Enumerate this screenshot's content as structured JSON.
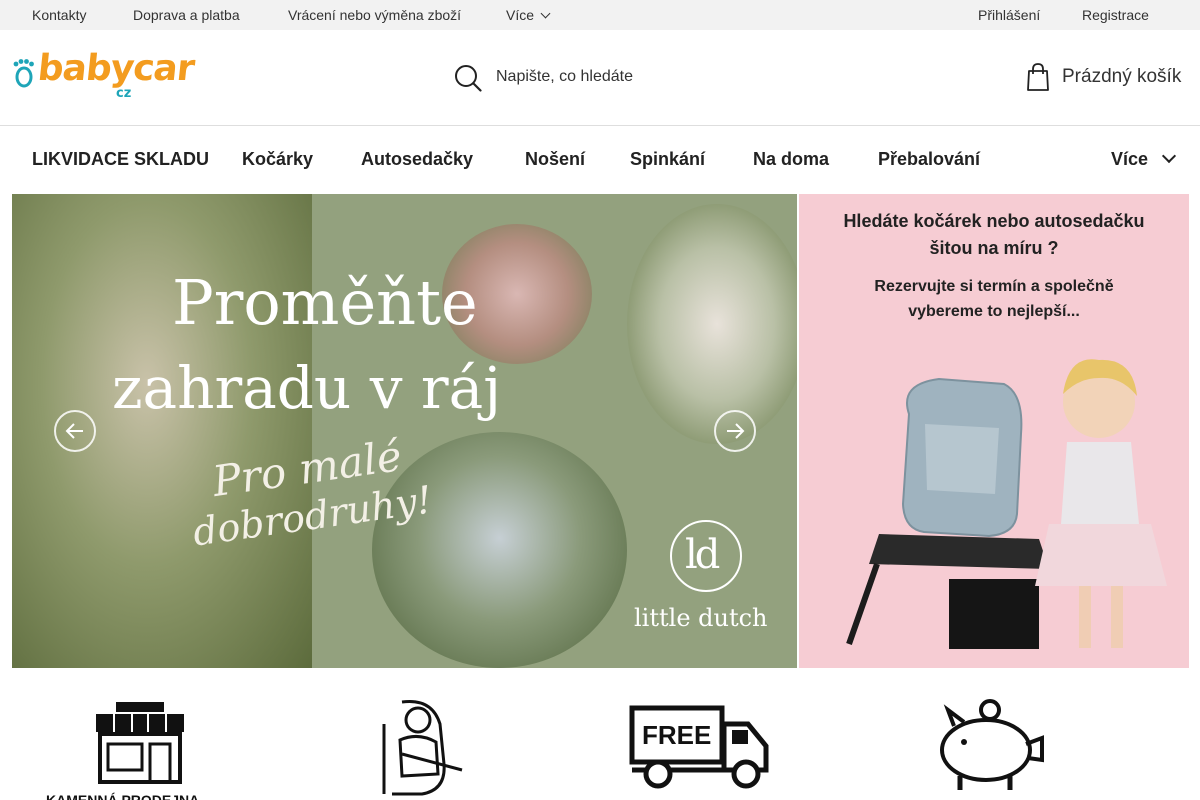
{
  "topbar": {
    "links": [
      "Kontakty",
      "Doprava a platba",
      "Vrácení nebo výměna zboží",
      "Více"
    ],
    "account": [
      "Přihlášení",
      "Registrace"
    ]
  },
  "header": {
    "logo_text": "babycar",
    "logo_suffix": "cz",
    "search_placeholder": "Napište, co hledáte",
    "cart_label": "Prázdný košík"
  },
  "categories": [
    "LIKVIDACE SKLADU",
    "Kočárky",
    "Autosedačky",
    "Nošení",
    "Spinkání",
    "Na doma",
    "Přebalování",
    "Více"
  ],
  "hero": {
    "title_line1": "Proměňte",
    "title_line2": "zahradu v ráj",
    "script_line1": "Pro malé",
    "script_line2": "dobrodruhy!",
    "brand_mark": "ld",
    "brand_name": "little dutch"
  },
  "promo": {
    "heading_line1": "Hledáte kočárek nebo autosedačku",
    "heading_line2": "šitou na míru ?",
    "sub_line1": "Rezervujte si termín a společně",
    "sub_line2": "vybereme to nejlepší..."
  },
  "features": {
    "store_caption": "KAMENNÁ PRODEJNA",
    "free_label": "FREE"
  },
  "colors": {
    "logo_orange": "#f39c1f",
    "logo_teal": "#1ea5b8",
    "hero_green": "#93a17e",
    "promo_pink": "#f6ccd3"
  }
}
